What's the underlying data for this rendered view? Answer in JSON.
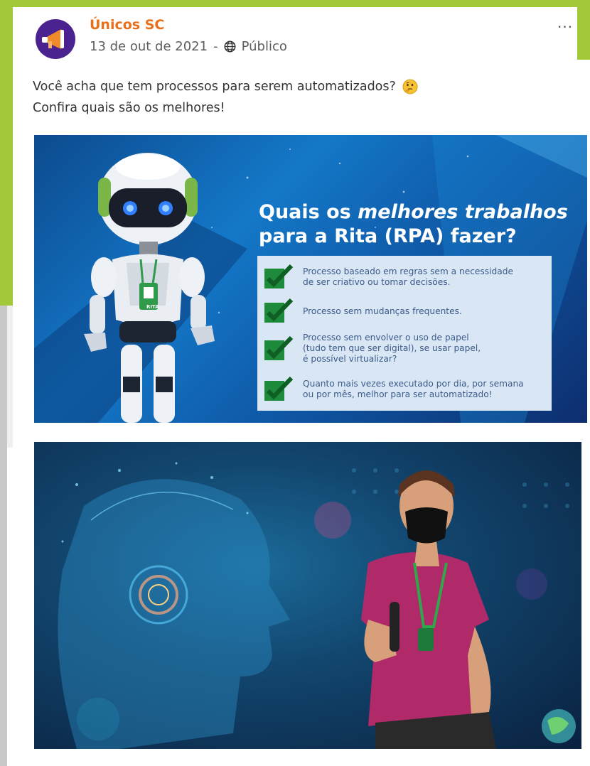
{
  "post": {
    "page_name": "Únicos SC",
    "date": "13 de out de 2021",
    "separator": "-",
    "visibility": "Público",
    "more_label": "···",
    "text_line1": "Você acha que tem processos para serem automatizados?",
    "text_line2": "Confira quais são os melhores!"
  },
  "banner": {
    "title_plain1": "Quais os ",
    "title_emph": "melhores trabalhos",
    "title_line2": "para a Rita (RPA) fazer?",
    "badge_label": "RITA",
    "items": [
      {
        "line1": "Processo baseado em regras sem a necessidade",
        "line2": "de ser criativo ou tomar decisões.",
        "line3": ""
      },
      {
        "line1": "Processo sem mudanças frequentes.",
        "line2": "",
        "line3": ""
      },
      {
        "line1": "Processo sem envolver o uso de papel",
        "line2": "(tudo tem que ser digital), se usar papel,",
        "line3": "é possível virtualizar?"
      },
      {
        "line1": "Quanto mais vezes executado por dia, por semana",
        "line2": "ou por mês, melhor para ser automatizado!",
        "line3": ""
      }
    ]
  },
  "colors": {
    "accent_green": "#a3c93a",
    "page_name": "#e8701a",
    "check_green": "#1e8a3c"
  }
}
